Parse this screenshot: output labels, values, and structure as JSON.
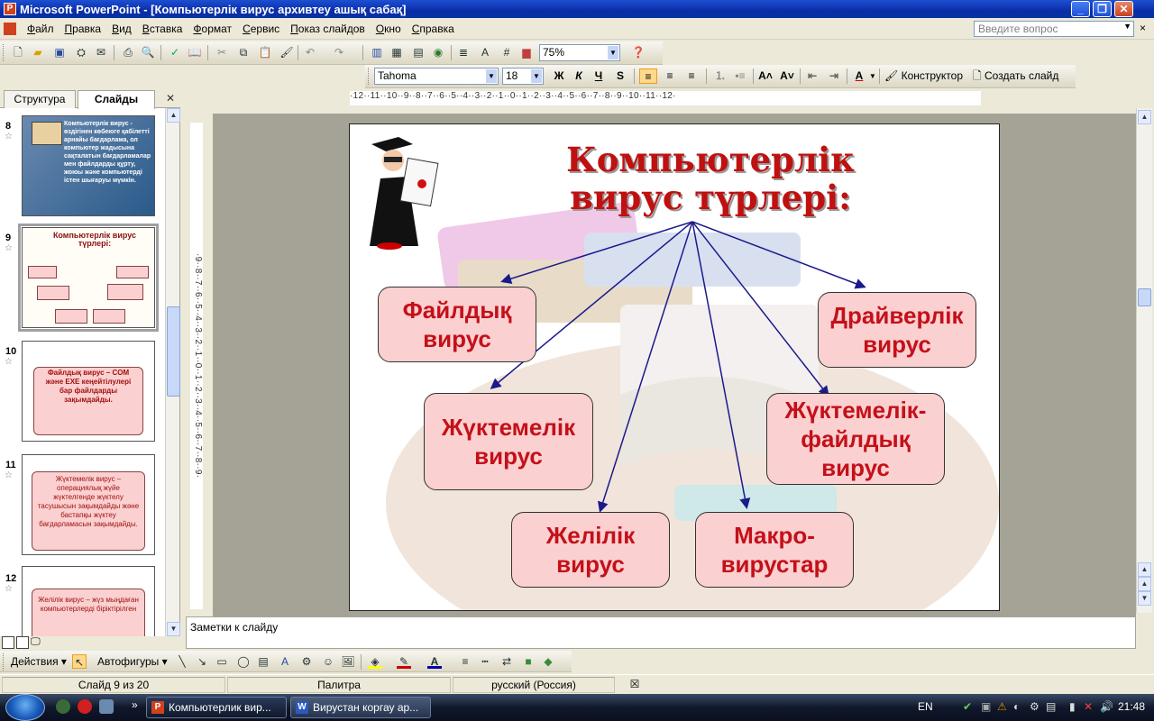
{
  "window": {
    "title": "Microsoft PowerPoint - [Компьютерлік вирус архивтеу ашық сабақ]",
    "min": "_",
    "restore": "❐",
    "close": "✕"
  },
  "menu": [
    "Файл",
    "Правка",
    "Вид",
    "Вставка",
    "Формат",
    "Сервис",
    "Показ слайдов",
    "Окно",
    "Справка"
  ],
  "help_box": {
    "placeholder": "Введите вопрос"
  },
  "toolbar": {
    "zoom": "75%"
  },
  "format_toolbar": {
    "font": "Tahoma",
    "size": "18",
    "bold": "Ж",
    "italic": "К",
    "underline": "Ч",
    "shadow": "S",
    "designer": "Конструктор",
    "new_slide": "Создать слайд"
  },
  "left_pane": {
    "tabs": [
      "Структура",
      "Слайды"
    ],
    "active_tab": "Слайды",
    "slides": [
      {
        "num": "8",
        "text": "Компьютерлік вирус - өздігінен көбеюге қабілетті арнайы бағдарлама, ол компьютер жадысына сақталатын бағдарламалар мен файлдарды құрту, жоюы және компьютерді істен шығаруы мүмкін."
      },
      {
        "num": "9",
        "text": "Компьютерлік вирус түрлері:"
      },
      {
        "num": "10",
        "text": "Файлдық вирус – COM және EXE кеңейтілулері бар файлдарды зақымдайды."
      },
      {
        "num": "11",
        "text": "Жүктемелік вирус – операциялық жүйе жүктелгенде жүктелу тасушысын зақымдайды және бастапқы жүктеу бағдарламасын зақымдайды."
      },
      {
        "num": "12",
        "text": "Желілік вирус – жүз мыңдаған компьютерлерді біріктірілген"
      }
    ]
  },
  "rulers": {
    "horizontal": "·12··11··10··9··8··7··6··5··4··3··2··1··0··1··2··3··4··5··6··7··8··9··10··11··12·",
    "vertical": "·9··8··7··6··5··4··3··2··1··0··1··2··3··4··5··6··7··8··9·"
  },
  "slide": {
    "title_line1": "Компьютерлік",
    "title_line2": "вирус түрлері:",
    "boxes": [
      "Файлдық вирус",
      "Драйверлік вирус",
      "Жүктемелік вирус",
      "Жүктемелік-файлдық вирус",
      "Желілік вирус",
      "Макро-вирустар"
    ],
    "colors": {
      "box_fill": "#fbd0d0",
      "text": "#c4101a",
      "arrow": "#1a1a8c"
    }
  },
  "notes": {
    "placeholder": "Заметки к слайду"
  },
  "draw_toolbar": {
    "actions": "Действия",
    "autoshapes": "Автофигуры"
  },
  "status": {
    "slide": "Слайд 9 из 20",
    "design": "Палитра",
    "language": "русский (Россия)"
  },
  "taskbar": {
    "tasks": [
      "Компьютерлик вир...",
      "Вирустан коргау ар..."
    ],
    "lang": "EN",
    "time": "21:48"
  }
}
